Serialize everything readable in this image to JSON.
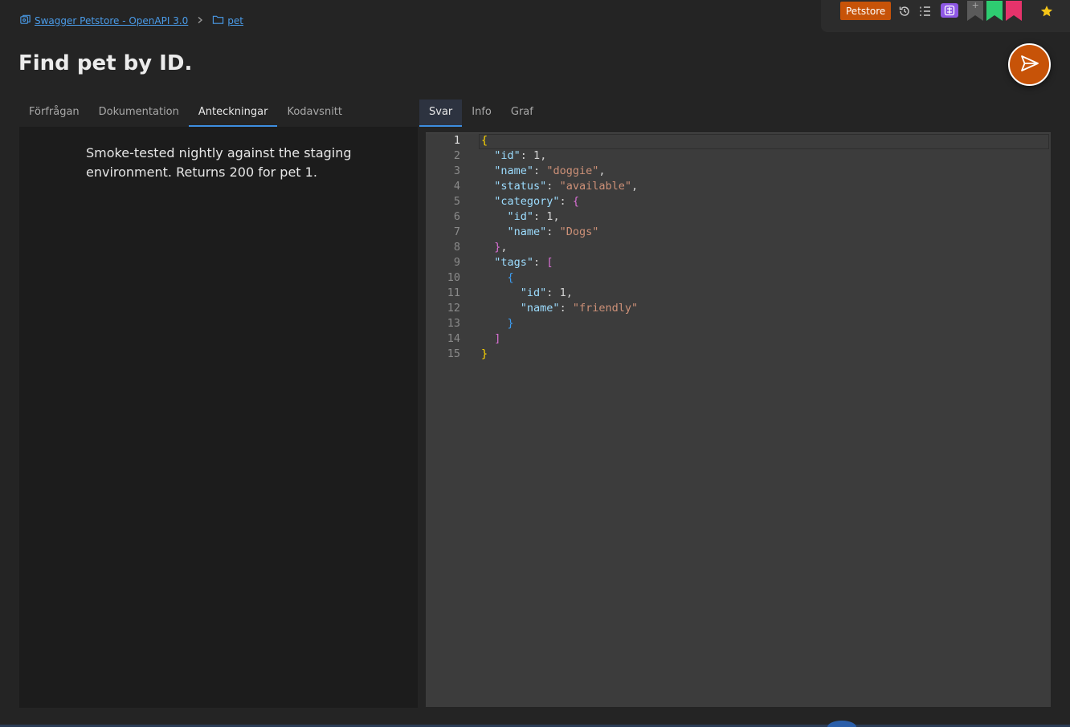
{
  "breadcrumb": {
    "collection": "Swagger Petstore - OpenAPI 3.0",
    "folder": "pet",
    "separator": ">"
  },
  "toolbar": {
    "environment": "Petstore",
    "icons": [
      "history-icon",
      "list-icon",
      "extension-icon",
      "bookmark-gray-icon",
      "bookmark-green-icon",
      "bookmark-pink-icon",
      "star-icon"
    ],
    "bookmark_plus": "+",
    "colors": {
      "env": "#c75308",
      "green": "#2ecc71",
      "pink": "#e6336b",
      "gray": "#5a5a5a",
      "star": "#f5c518",
      "ext": "#8e57e4"
    }
  },
  "page": {
    "title": "Find pet by ID."
  },
  "left_tabs": [
    {
      "label": "Förfrågan",
      "active": false
    },
    {
      "label": "Dokumentation",
      "active": false
    },
    {
      "label": "Anteckningar",
      "active": true
    },
    {
      "label": "Kodavsnitt",
      "active": false
    }
  ],
  "right_tabs": [
    {
      "label": "Svar",
      "active": true
    },
    {
      "label": "Info",
      "active": false
    },
    {
      "label": "Graf",
      "active": false
    }
  ],
  "notes": {
    "text": "Smoke-tested nightly against the staging environment. Returns 200 for pet 1."
  },
  "response": {
    "lines": [
      "1",
      "2",
      "3",
      "4",
      "5",
      "6",
      "7",
      "8",
      "9",
      "10",
      "11",
      "12",
      "13",
      "14",
      "15"
    ],
    "body": {
      "id": "1",
      "name": "doggie",
      "status": "available",
      "category_id": "1",
      "category_name": "Dogs",
      "tag_id": "1",
      "tag_name": "friendly"
    },
    "keys": {
      "id": "\"id\"",
      "name": "\"name\"",
      "status": "\"status\"",
      "category": "\"category\"",
      "tags": "\"tags\""
    }
  }
}
